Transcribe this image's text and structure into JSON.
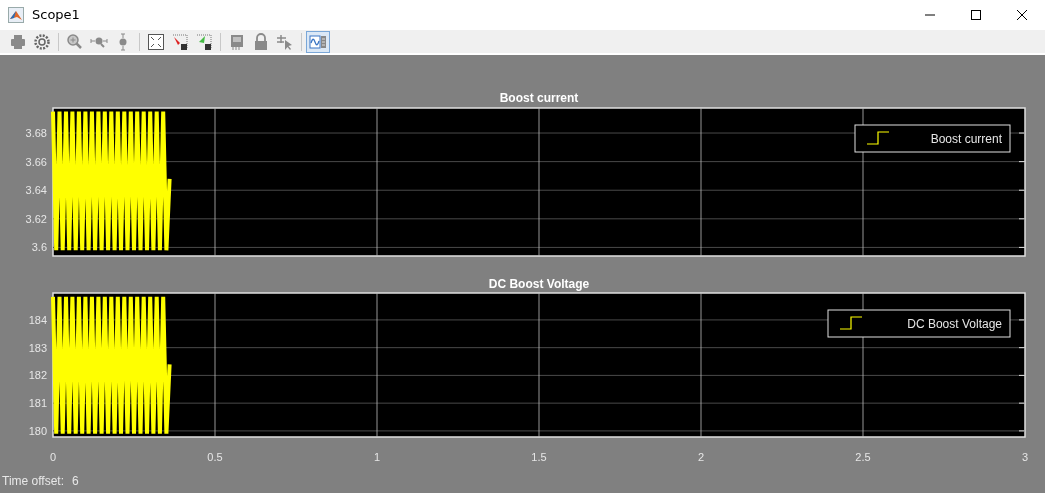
{
  "window": {
    "title": "Scope1"
  },
  "toolbar": [
    {
      "buttons": [
        {
          "kind": "print",
          "selected": false
        },
        {
          "kind": "settings",
          "selected": false
        }
      ]
    },
    {
      "buttons": [
        {
          "kind": "zoom-in",
          "selected": false
        },
        {
          "kind": "zoom-x",
          "selected": false
        },
        {
          "kind": "zoom-y",
          "selected": false
        }
      ]
    },
    {
      "buttons": [
        {
          "kind": "fit",
          "selected": false
        },
        {
          "kind": "save-axes",
          "selected": false
        },
        {
          "kind": "restore-axes",
          "selected": false
        }
      ]
    },
    {
      "buttons": [
        {
          "kind": "memory",
          "selected": false
        },
        {
          "kind": "lock",
          "selected": false
        },
        {
          "kind": "cursor",
          "selected": false
        }
      ]
    },
    {
      "buttons": [
        {
          "kind": "legend",
          "selected": true
        }
      ]
    }
  ],
  "plots": [
    {
      "chart_data": {
        "type": "line",
        "title": "Boost current",
        "grid": true,
        "x": [
          0,
          0.01,
          0.02,
          0.03,
          0.04,
          0.05,
          0.06,
          0.07,
          0.08,
          0.09,
          0.1,
          0.11,
          0.12,
          0.13,
          0.14,
          0.15,
          0.16,
          0.17,
          0.18,
          0.19,
          0.2,
          0.21,
          0.22,
          0.23,
          0.24,
          0.25,
          0.26,
          0.27,
          0.28,
          0.29,
          0.3,
          0.31,
          0.32,
          0.33,
          0.34,
          0.35,
          0.36
        ],
        "series": [
          {
            "name": "Boost current",
            "color": "#ffff00",
            "values": [
              3.695,
              3.598,
              3.695,
              3.598,
              3.695,
              3.598,
              3.695,
              3.598,
              3.695,
              3.598,
              3.695,
              3.598,
              3.695,
              3.598,
              3.695,
              3.598,
              3.695,
              3.598,
              3.695,
              3.598,
              3.695,
              3.598,
              3.695,
              3.598,
              3.695,
              3.598,
              3.695,
              3.598,
              3.695,
              3.598,
              3.695,
              3.598,
              3.695,
              3.598,
              3.695,
              3.598,
              3.648
            ]
          }
        ],
        "xlim": [
          0,
          3
        ],
        "ylim": [
          3.594,
          3.6975
        ],
        "yticks": [
          {
            "value": 3.6,
            "label": "3.6"
          },
          {
            "value": 3.62,
            "label": "3.62"
          },
          {
            "value": 3.64,
            "label": "3.64"
          },
          {
            "value": 3.66,
            "label": "3.66"
          },
          {
            "value": 3.68,
            "label": "3.68"
          }
        ]
      }
    },
    {
      "chart_data": {
        "type": "line",
        "title": "DC Boost Voltage",
        "grid": true,
        "x": [
          0,
          0.01,
          0.02,
          0.03,
          0.04,
          0.05,
          0.06,
          0.07,
          0.08,
          0.09,
          0.1,
          0.11,
          0.12,
          0.13,
          0.14,
          0.15,
          0.16,
          0.17,
          0.18,
          0.19,
          0.2,
          0.21,
          0.22,
          0.23,
          0.24,
          0.25,
          0.26,
          0.27,
          0.28,
          0.29,
          0.3,
          0.31,
          0.32,
          0.33,
          0.34,
          0.35,
          0.36
        ],
        "series": [
          {
            "name": "DC Boost Voltage",
            "color": "#ffff00",
            "values": [
              184.83,
              179.9,
              184.83,
              179.9,
              184.83,
              179.9,
              184.83,
              179.9,
              184.83,
              179.9,
              184.83,
              179.9,
              184.83,
              179.9,
              184.83,
              179.9,
              184.83,
              179.9,
              184.83,
              179.9,
              184.83,
              179.9,
              184.83,
              179.9,
              184.83,
              179.9,
              184.83,
              179.9,
              184.83,
              179.9,
              184.83,
              179.9,
              184.83,
              179.9,
              184.83,
              179.9,
              182.4
            ]
          }
        ],
        "xlim": [
          0,
          3
        ],
        "ylim": [
          179.78,
          184.97
        ],
        "xticks": [
          {
            "value": 0,
            "label": "0"
          },
          {
            "value": 0.5,
            "label": "0.5"
          },
          {
            "value": 1,
            "label": "1"
          },
          {
            "value": 1.5,
            "label": "1.5"
          },
          {
            "value": 2,
            "label": "2"
          },
          {
            "value": 2.5,
            "label": "2.5"
          },
          {
            "value": 3,
            "label": "3"
          }
        ],
        "yticks": [
          {
            "value": 180,
            "label": "180"
          },
          {
            "value": 181,
            "label": "181"
          },
          {
            "value": 182,
            "label": "182"
          },
          {
            "value": 183,
            "label": "183"
          },
          {
            "value": 184,
            "label": "184"
          }
        ]
      }
    }
  ],
  "status_bar": {
    "label": "Time offset:",
    "value": "6"
  }
}
